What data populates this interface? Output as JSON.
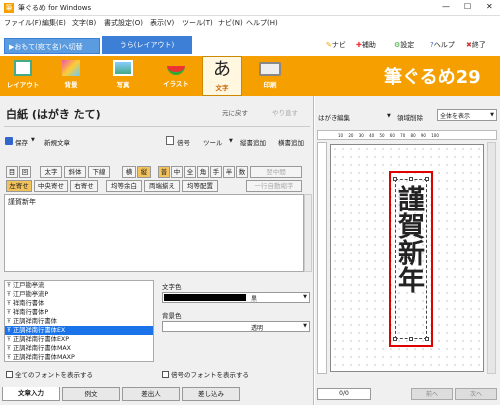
{
  "window": {
    "title": "筆ぐるめ for Windows",
    "menu": [
      "ファイル(F)",
      "編集(E)",
      "文字(B)",
      "書式設定(O)",
      "表示(V)",
      "ツール(T)",
      "ナビ(N)",
      "ヘルプ(H)"
    ],
    "controls": [
      "—",
      "☐",
      "✕"
    ]
  },
  "side_toggle": "▶おもて(宛て名)へ切替",
  "side_tab": "うら(レイアウト)",
  "right_tools": [
    "ナビ",
    "補助",
    "設定",
    "ヘルプ",
    "終了"
  ],
  "ribbon": {
    "tabs": [
      "レイアウト",
      "背景",
      "写真",
      "イラスト",
      "文字",
      "印刷"
    ],
    "brand": "筆ぐるめ29"
  },
  "doc": {
    "title": "白紙 (はがき たて)",
    "undo": "元に戻す",
    "redo": "やり直す",
    "save": "保存",
    "new": "新規文章",
    "kaiin": "倍号",
    "tool": "ツール",
    "vert_add": "縦書追加",
    "horz_add": "横書追加"
  },
  "fmt_row1": [
    "目",
    "回",
    "太字",
    "斜体",
    "下線",
    "横",
    "縦",
    "普",
    "中",
    "全",
    "角",
    "手",
    "半",
    "数",
    "翌中間"
  ],
  "fmt_row2": [
    "左寄せ",
    "中央寄せ",
    "右寄せ",
    "均等余白",
    "両端揃え",
    "均等配置",
    "一行自動縮字"
  ],
  "text_content": "謹賀新年",
  "fonts": [
    "江戸勘亭流",
    "江戸勘亭流P",
    "祥南行書体",
    "祥南行書体P",
    "正調祥南行書体",
    "正調祥南行書体EX",
    "正調祥南行書体EXP",
    "正調祥南行書体MAX",
    "正調祥南行書体MAXP"
  ],
  "font_selected_index": 5,
  "color": {
    "label": "文字色",
    "value": "黒",
    "bg_label": "背景色",
    "bg_value": "透明"
  },
  "checks": [
    "全てのフォントを表示する",
    "倍号のフォントを表示する"
  ],
  "bottom_tabs": [
    "文章入力",
    "例文",
    "差出人",
    "差し込み"
  ],
  "preview": {
    "label": "はがき",
    "edit": "編集",
    "clear": "領域削除",
    "view": "全体を表示",
    "ruler": "10 20 30 40 50 60 70 80 90 100",
    "card_text": "謹賀新年",
    "page": "0/0",
    "prev": "前へ",
    "next": "次へ"
  },
  "colors": {
    "accent": "#f5a000",
    "blue": "#3d7fd6",
    "red": "#e00000",
    "sel": "#1a73e8"
  }
}
